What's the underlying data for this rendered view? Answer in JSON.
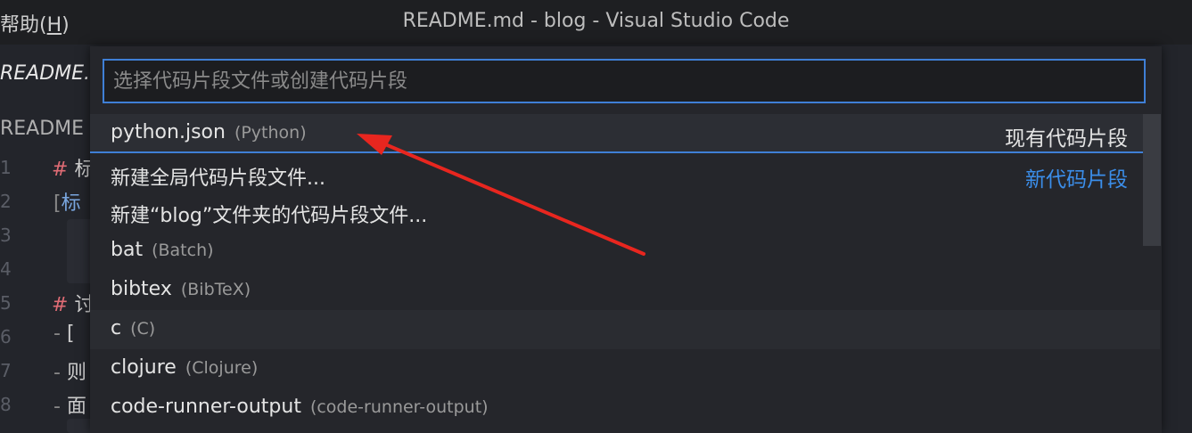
{
  "titlebar": {
    "menu_help": "帮助(",
    "menu_help_key": "H",
    "menu_help_close": ")",
    "window_title": "README.md - blog - Visual Studio Code"
  },
  "editor": {
    "active_tab": "README.m",
    "breadcrumb": "README",
    "line_numbers": [
      "1",
      "2",
      "3",
      "4",
      "5",
      "6",
      "7",
      "8"
    ],
    "fragments": {
      "l1_hash": "#",
      "l1_text": "标",
      "l2_bracket": "[",
      "l2_text": "标",
      "l5_hash": "#",
      "l5_text": "讨",
      "l6_dash": "-",
      "l6_text": "[",
      "l7_dash": "-",
      "l7_text": "则",
      "l8_dash": "-",
      "l8_text": "面"
    }
  },
  "quickpick": {
    "placeholder": "选择代码片段文件或创建代码片段",
    "items": [
      {
        "label": "python.json",
        "description": "(Python)",
        "group": "现有代码片段"
      },
      {
        "label": "新建全局代码片段文件...",
        "description": "",
        "group": "新代码片段"
      },
      {
        "label": "新建“blog”文件夹的代码片段文件...",
        "description": "",
        "group": ""
      },
      {
        "label": "bat",
        "description": "(Batch)",
        "group": ""
      },
      {
        "label": "bibtex",
        "description": "(BibTeX)",
        "group": ""
      },
      {
        "label": "c",
        "description": "(C)",
        "group": ""
      },
      {
        "label": "clojure",
        "description": "(Clojure)",
        "group": ""
      },
      {
        "label": "code-runner-output",
        "description": "(code-runner-output)",
        "group": ""
      }
    ]
  },
  "colors": {
    "accent": "#3f7fd6",
    "group_new": "#3b8eea",
    "annotation_arrow": "#e8261f"
  }
}
